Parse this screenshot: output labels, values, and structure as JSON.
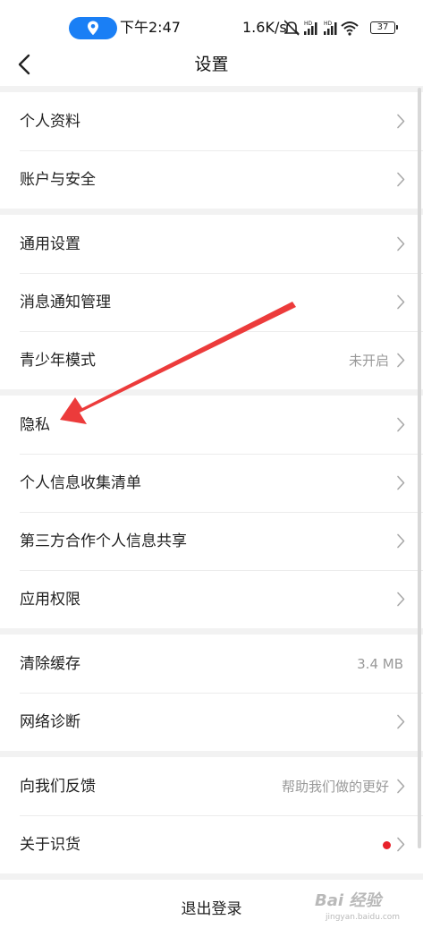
{
  "status_bar": {
    "time": "下午2:47",
    "net_speed": "1.6K/s",
    "battery": "37",
    "icons": [
      "location-icon",
      "mute-icon",
      "hd-signal-icon",
      "hd-signal-icon",
      "wifi-icon",
      "battery-icon"
    ]
  },
  "nav": {
    "title": "设置",
    "back_icon": "chevron-left-icon"
  },
  "groups": [
    [
      {
        "label": "个人资料",
        "value": "",
        "chevron": true
      },
      {
        "label": "账户与安全",
        "value": "",
        "chevron": true
      }
    ],
    [
      {
        "label": "通用设置",
        "value": "",
        "chevron": true
      },
      {
        "label": "消息通知管理",
        "value": "",
        "chevron": true
      },
      {
        "label": "青少年模式",
        "value": "未开启",
        "chevron": true
      }
    ],
    [
      {
        "label": "隐私",
        "value": "",
        "chevron": true
      },
      {
        "label": "个人信息收集清单",
        "value": "",
        "chevron": true
      },
      {
        "label": "第三方合作个人信息共享",
        "value": "",
        "chevron": true
      },
      {
        "label": "应用权限",
        "value": "",
        "chevron": true
      }
    ],
    [
      {
        "label": "清除缓存",
        "value": "3.4 MB",
        "chevron": false
      },
      {
        "label": "网络诊断",
        "value": "",
        "chevron": true
      }
    ],
    [
      {
        "label": "向我们反馈",
        "value": "帮助我们做的更好",
        "chevron": true
      },
      {
        "label": "关于识货",
        "value": "",
        "chevron": true,
        "red_dot": true
      }
    ]
  ],
  "logout_label": "退出登录",
  "colors": {
    "background": "#f2f2f2",
    "card": "#ffffff",
    "accent_blue": "#1a7ff5",
    "annotation_red": "#ec3b3b",
    "red_dot": "#e8212a"
  },
  "watermark": {
    "main": "Bai 经验",
    "sub": "jingyan.baidu.com"
  }
}
